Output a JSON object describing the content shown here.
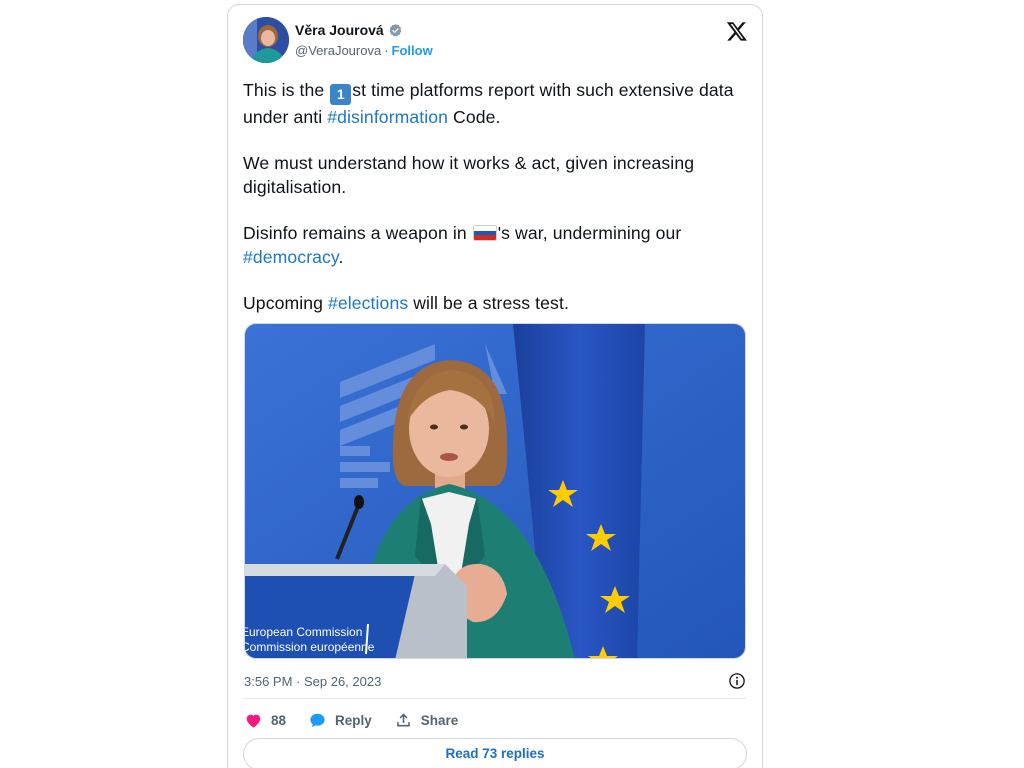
{
  "author": {
    "name": "Věra Jourová",
    "handle": "@VeraJourova",
    "separator": "·",
    "follow_label": "Follow"
  },
  "tweet": {
    "p1_before_emoji": "This is the ",
    "p1_emoji": "1",
    "p1_after_emoji": "st time platforms report with such extensive data under anti ",
    "p1_hashtag": "#disinformation",
    "p1_end": " Code.",
    "p2": "We must understand how it works & act, given increasing digitalisation.",
    "p3_before_flag": "Disinfo remains a weapon in ",
    "p3_after_flag": "'s war, undermining our ",
    "p3_hashtag": "#democracy",
    "p3_end": ".",
    "p4_before": "Upcoming ",
    "p4_hashtag": "#elections",
    "p4_end": " will be a stress test."
  },
  "photo": {
    "podium_line1": "European Commission",
    "podium_line2": "Commission européenne"
  },
  "meta": {
    "timestamp": "3:56 PM · Sep 26, 2023"
  },
  "actions": {
    "like_count": "88",
    "reply_label": "Reply",
    "share_label": "Share"
  },
  "replies_button": "Read 73 replies",
  "colors": {
    "hashtag": "#1d77c7",
    "like": "#f91880",
    "reply": "#1d9bf0",
    "eu_blue": "#1f4fb0",
    "eu_star": "#ffcc00"
  },
  "icons": {
    "verified": "verified-badge-icon",
    "x_logo": "x-logo-icon",
    "info": "info-icon",
    "like": "heart-icon",
    "reply": "speech-bubble-icon",
    "share": "share-upload-icon"
  }
}
